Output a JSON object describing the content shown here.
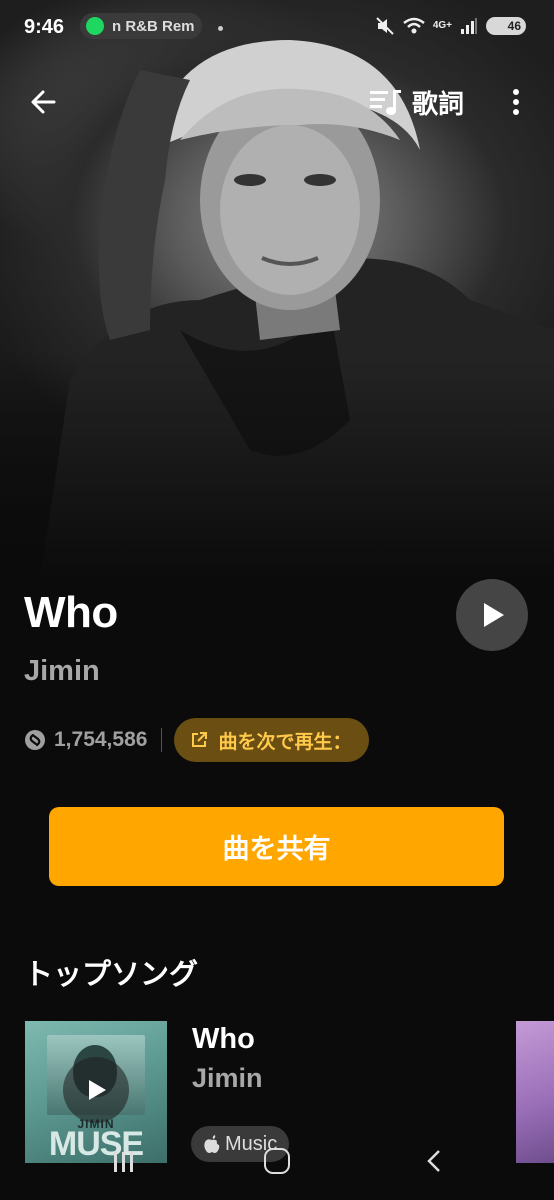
{
  "status_bar": {
    "time": "9:46",
    "media_pill_text": "n R&B Rem",
    "network": "4G+",
    "battery": "46"
  },
  "nav": {
    "back_icon": "arrow-left-icon",
    "lyrics_label": "歌詞",
    "more_icon": "kebab-icon"
  },
  "track": {
    "title": "Who",
    "artist": "Jimin",
    "shazam_count": "1,754,586",
    "play_next_label": "曲を次で再生："
  },
  "actions": {
    "share_label": "曲を共有"
  },
  "top_songs": {
    "heading": "トップソング",
    "items": [
      {
        "title": "Who",
        "artist": "Jimin",
        "cover_text_small": "JIMIN",
        "cover_text_large": "MUSE",
        "badge": "Music"
      }
    ]
  },
  "colors": {
    "accent": "#ffa600",
    "pill_bg": "#6b4e12",
    "pill_text": "#ffc94a",
    "background": "#0b0b0b"
  }
}
